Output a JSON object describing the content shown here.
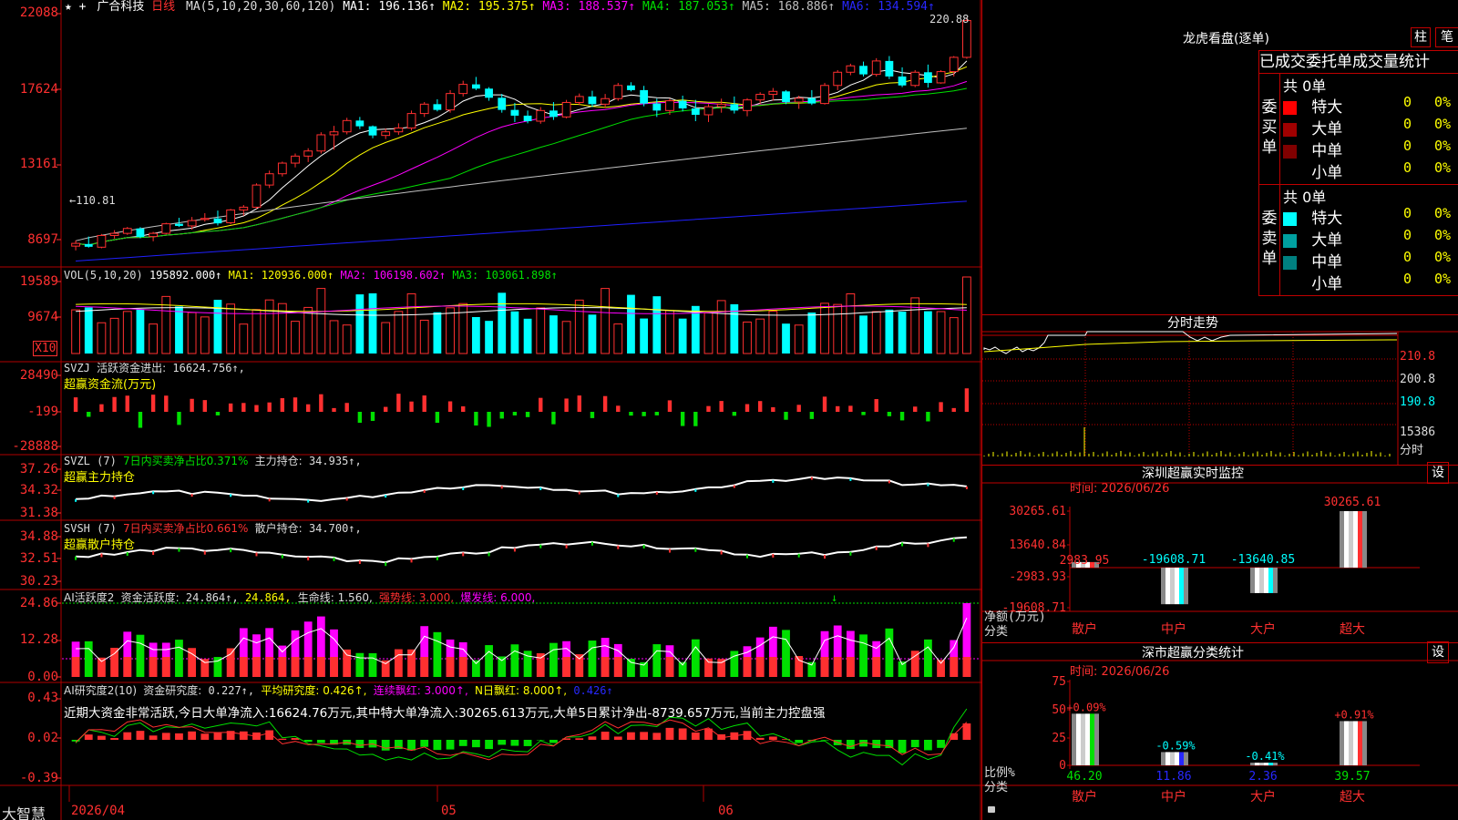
{
  "stock": {
    "star": "★",
    "name": "广合科技",
    "period": "日线",
    "plus": "+"
  },
  "ma": {
    "header": "MA(5,10,20,30,60,120)",
    "items": [
      {
        "label": "MA1: 196.136↑",
        "color": "#ffffff"
      },
      {
        "label": "MA2: 195.375↑",
        "color": "#ffff00"
      },
      {
        "label": "MA3: 188.537↑",
        "color": "#ff00ff"
      },
      {
        "label": "MA4: 187.053↑",
        "color": "#00e000"
      },
      {
        "label": "MA5: 168.886↑",
        "color": "#c0c0c0"
      },
      {
        "label": "MA6: 134.594↑",
        "color": "#2020ff"
      }
    ]
  },
  "colors": {
    "up": "#ff3030",
    "down": "#00ffff",
    "green": "#00e000",
    "magenta": "#ff00ff",
    "yellow": "#ffff00",
    "grid": "#b00000",
    "axis": "#ff3030"
  },
  "price_panel": {
    "y_ticks": [
      "22088",
      "17624",
      "13161",
      "8697"
    ],
    "high_label": "220.88",
    "low_label": "110.81",
    "low_arrow": "←"
  },
  "vol_panel": {
    "header": "VOL(5,10,20)",
    "value": "195892.000↑",
    "ma1": "MA1: 120936.000↑",
    "ma2": "MA2: 106198.602↑",
    "ma3": "MA3: 103061.898↑",
    "y_ticks": [
      "19589",
      "9674"
    ],
    "unit": "X10"
  },
  "svzj_panel": {
    "header": "SVZJ",
    "label": "活跃资金进出:",
    "value": "16624.756↑,",
    "subtitle": "超赢资金流(万元)",
    "y_ticks": [
      "28490",
      "-199",
      "-28888"
    ]
  },
  "svzl_panel": {
    "header": "SVZL (7)",
    "label1": "7日内买卖净占比0.371%",
    "label2": "主力持仓:",
    "value": "34.935↑,",
    "subtitle": "超赢主力持仓",
    "y_ticks": [
      "37.26",
      "34.32",
      "31.38"
    ]
  },
  "svsh_panel": {
    "header": "SVSH (7)",
    "label1": "7日内买卖净占比0.661%",
    "label2": "散户持仓:",
    "value": "34.700↑,",
    "subtitle": "超赢散户持仓",
    "y_ticks": [
      "34.88",
      "32.51",
      "30.23"
    ]
  },
  "ai2_panel": {
    "header": "AI活跃度2",
    "label": "资金活跃度:",
    "v1": "24.864↑,",
    "v2": "24.864,",
    "life": "生命线: 1.560,",
    "strong": "强势线: 3.000,",
    "burst": "爆发线: 6.000,",
    "y_ticks": [
      "24.86",
      "12.28",
      "0.00"
    ]
  },
  "ai_study_panel": {
    "header": "AI研究度2(10)",
    "label": "资金研究度:",
    "value": "0.227↑,",
    "avg": "平均研究度: 0.426↑,",
    "streak": "连续飘红: 3.000↑,",
    "nday": "N日飘红: 8.000↑,",
    "nval": "0.426↑",
    "note": "近期大资金非常活跃,今日大单净流入:16624.76万元,其中特大单净流入:30265.613万元,大单5日累计净出-8739.657万元,当前主力控盘强",
    "y_ticks": [
      "0.43",
      "0.02",
      "-0.39"
    ]
  },
  "x_axis": {
    "labels": [
      "2026/04",
      "05",
      "06"
    ],
    "brand": "大智慧"
  },
  "dragon": {
    "title": "龙虎看盘(逐单)",
    "btn_bar": "柱",
    "btn_pen": "笔",
    "tabs": [
      "已成交",
      "委托单",
      "成交量",
      "统计"
    ],
    "buy": {
      "side_label": "委买单",
      "total": "共 0单",
      "rows": [
        {
          "label": "特大",
          "value": "0",
          "pct": "0%",
          "color": "#ff0000"
        },
        {
          "label": "大单",
          "value": "0",
          "pct": "0%",
          "color": "#a00000"
        },
        {
          "label": "中单",
          "value": "0",
          "pct": "0%",
          "color": "#800000"
        },
        {
          "label": "小单",
          "value": "0",
          "pct": "0%",
          "color": ""
        }
      ]
    },
    "sell": {
      "side_label": "委卖单",
      "total": "共 0单",
      "rows": [
        {
          "label": "特大",
          "value": "0",
          "pct": "0%",
          "color": "#00ffff"
        },
        {
          "label": "大单",
          "value": "0",
          "pct": "0%",
          "color": "#00a0a0"
        },
        {
          "label": "中单",
          "value": "0",
          "pct": "0%",
          "color": "#008080"
        },
        {
          "label": "小单",
          "value": "0",
          "pct": "0%",
          "color": ""
        }
      ]
    }
  },
  "intraday": {
    "title": "分时走势",
    "y_ticks": [
      "210.8",
      "200.8",
      "190.8",
      "15386"
    ],
    "bottom_label": "分时"
  },
  "monitor": {
    "title": "深圳超赢实时监控",
    "settings": "设",
    "time": "时间: 2026/06/26",
    "y_ticks": [
      "30265.61",
      "13640.84",
      "-2983.93",
      "-19608.71"
    ],
    "y_title": "净额(万元)",
    "x_title": "分类",
    "categories": [
      "散户",
      "中户",
      "大户",
      "超大"
    ],
    "values": [
      2983.95,
      -19608.71,
      -13640.85,
      30265.61
    ],
    "value_labels": [
      "2983.95",
      "-19608.71",
      "-13640.85",
      "30265.61"
    ]
  },
  "classify": {
    "title": "深市超赢分类统计",
    "settings": "设",
    "time": "时间: 2026/06/26",
    "y_ticks": [
      "75",
      "50",
      "25",
      "0"
    ],
    "y_title": "比例%",
    "x_title": "分类",
    "categories": [
      "散户",
      "中户",
      "大户",
      "超大"
    ],
    "values": [
      46.2,
      11.86,
      2.36,
      39.57
    ],
    "value_labels": [
      "46.20",
      "11.86",
      "2.36",
      "39.57"
    ],
    "change_labels": [
      "+0.09%",
      "-0.59%",
      "-0.41%",
      "+0.91%"
    ]
  },
  "chart_data": {
    "type": "candlestick",
    "title": "广合科技 日线",
    "note": "daily candlesticks Apr–Jun 2026, prices in yuan; OHLC estimated from the axes",
    "candles": [
      [
        113.5,
        116.2,
        111.5,
        114.8
      ],
      [
        114.5,
        118,
        112.8,
        113.2
      ],
      [
        113,
        119.2,
        112.5,
        118.5
      ],
      [
        118.5,
        121,
        117,
        119.5
      ],
      [
        119.5,
        122.5,
        118.8,
        121.8
      ],
      [
        121.8,
        122.4,
        117.2,
        117.8
      ],
      [
        118,
        120.2,
        115.8,
        119.5
      ],
      [
        119.5,
        124.5,
        119,
        124
      ],
      [
        124,
        126.8,
        122.5,
        123
      ],
      [
        123,
        127.2,
        121.2,
        125.5
      ],
      [
        126,
        129,
        125,
        126.5
      ],
      [
        126.5,
        130.2,
        123.2,
        124.2
      ],
      [
        124.5,
        131,
        123.8,
        130.5
      ],
      [
        130.5,
        132.8,
        127.8,
        131.8
      ],
      [
        131.8,
        143,
        131,
        142.2
      ],
      [
        142.2,
        149,
        140.8,
        147.5
      ],
      [
        147.5,
        153.2,
        146.2,
        152.5
      ],
      [
        152.5,
        157,
        150.5,
        155.8
      ],
      [
        155.8,
        159.5,
        153,
        158.2
      ],
      [
        158.2,
        167,
        157,
        165.8
      ],
      [
        165.8,
        170,
        158.8,
        167.2
      ],
      [
        167.2,
        173.8,
        166,
        172.5
      ],
      [
        172.5,
        174.2,
        168.5,
        169.8
      ],
      [
        169.8,
        170.2,
        164.2,
        165.5
      ],
      [
        165.5,
        168.8,
        163.8,
        167.2
      ],
      [
        167.2,
        171.2,
        165.8,
        169
      ],
      [
        169,
        177.2,
        167.8,
        175.8
      ],
      [
        175.8,
        181.2,
        174.2,
        180.2
      ],
      [
        180.2,
        182.5,
        176.8,
        177.5
      ],
      [
        177.5,
        186.8,
        176.2,
        185.2
      ],
      [
        185.2,
        191.2,
        183.8,
        189.5
      ],
      [
        189.5,
        193,
        186.8,
        187.5
      ],
      [
        187.5,
        188.2,
        181.8,
        183.2
      ],
      [
        183.2,
        185,
        176.2,
        177.5
      ],
      [
        177.5,
        180.8,
        171.8,
        174.8
      ],
      [
        174.8,
        177.2,
        171.2,
        172.2
      ],
      [
        172.2,
        178.8,
        171,
        177.2
      ],
      [
        177.2,
        181.2,
        172.8,
        174.2
      ],
      [
        174.2,
        182.2,
        173.5,
        181
      ],
      [
        181,
        185.2,
        179.8,
        183.8
      ],
      [
        183.8,
        186.5,
        178.8,
        180.2
      ],
      [
        180.2,
        185,
        178.5,
        182.8
      ],
      [
        182.8,
        190.2,
        181.8,
        189
      ],
      [
        189,
        190.5,
        186.2,
        186.8
      ],
      [
        186.8,
        188.8,
        179.2,
        180.5
      ],
      [
        180.5,
        182.8,
        174.2,
        177.2
      ],
      [
        177.2,
        182.8,
        175.2,
        181.8
      ],
      [
        181.8,
        184.2,
        176.8,
        178.2
      ],
      [
        178.2,
        182.2,
        172.2,
        175.2
      ],
      [
        175.2,
        180.2,
        171.8,
        179
      ],
      [
        179,
        182.8,
        176.2,
        180.2
      ],
      [
        180.2,
        183.8,
        175.8,
        177.2
      ],
      [
        177.2,
        183,
        174.5,
        182.2
      ],
      [
        182.2,
        185.8,
        180.2,
        184.8
      ],
      [
        184.8,
        187.8,
        181.8,
        186.2
      ],
      [
        186.2,
        186.8,
        180.2,
        181.2
      ],
      [
        181.2,
        184.2,
        178,
        183
      ],
      [
        183,
        186.8,
        179.8,
        180.5
      ],
      [
        180.5,
        190.2,
        180,
        189
      ],
      [
        189,
        196.2,
        186.8,
        195.2
      ],
      [
        195.2,
        199.2,
        193.8,
        198.2
      ],
      [
        198.2,
        200.2,
        193.2,
        194.2
      ],
      [
        194.2,
        201.8,
        193.2,
        200.5
      ],
      [
        200.5,
        202.8,
        192,
        193.2
      ],
      [
        193.2,
        197.5,
        188.2,
        189
      ],
      [
        189,
        196.2,
        188.2,
        195.2
      ],
      [
        195.2,
        198.8,
        188,
        190.2
      ],
      [
        190.2,
        196.2,
        189.8,
        195.5
      ],
      [
        195.5,
        202.8,
        193.2,
        202.2
      ],
      [
        202.2,
        220.9,
        201.5,
        219.5
      ]
    ]
  }
}
